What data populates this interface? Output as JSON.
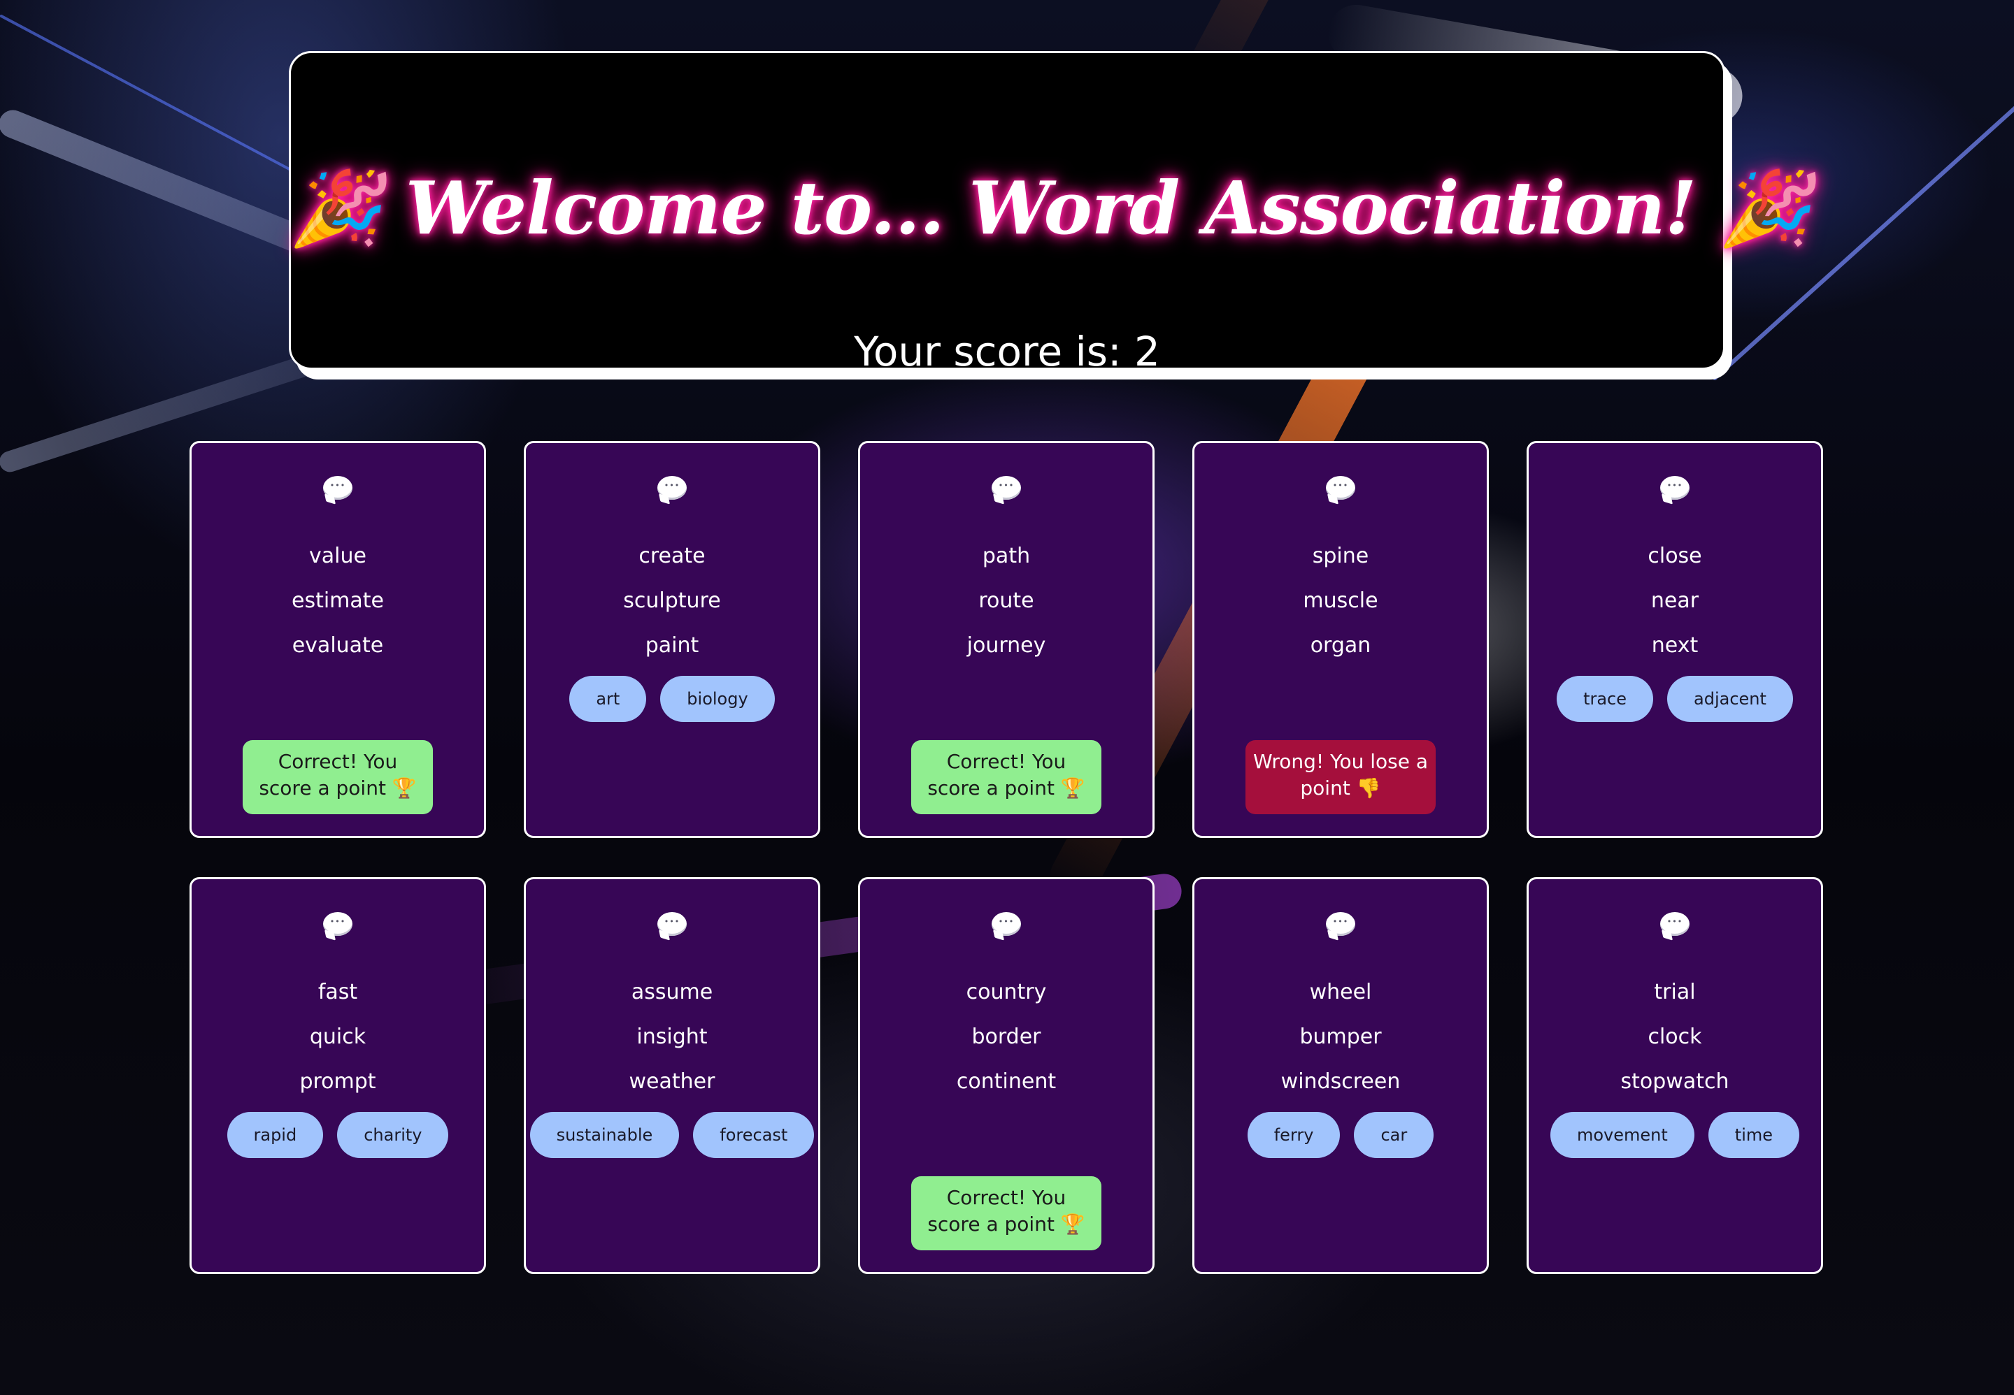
{
  "header": {
    "title": "🎉 Welcome to... Word Association! 🎉",
    "score_label": "Your score is: 2"
  },
  "colors": {
    "card_bg": "#370656",
    "chip_bg": "#a1c4fd",
    "correct_bg": "#90ee90",
    "wrong_bg": "#a50f3c",
    "title_glow": "#ff1493"
  },
  "cards": [
    {
      "words": [
        "value",
        "estimate",
        "evaluate"
      ],
      "options": [],
      "result": "Correct! You score a point 🏆",
      "result_type": "correct"
    },
    {
      "words": [
        "create",
        "sculpture",
        "paint"
      ],
      "options": [
        "art",
        "biology"
      ],
      "result": "",
      "result_type": "none"
    },
    {
      "words": [
        "path",
        "route",
        "journey"
      ],
      "options": [],
      "result": "Correct! You score a point 🏆",
      "result_type": "correct"
    },
    {
      "words": [
        "spine",
        "muscle",
        "organ"
      ],
      "options": [],
      "result": "Wrong! You lose a point 👎",
      "result_type": "wrong"
    },
    {
      "words": [
        "close",
        "near",
        "next"
      ],
      "options": [
        "trace",
        "adjacent"
      ],
      "result": "",
      "result_type": "none"
    },
    {
      "words": [
        "fast",
        "quick",
        "prompt"
      ],
      "options": [
        "rapid",
        "charity"
      ],
      "result": "",
      "result_type": "none"
    },
    {
      "words": [
        "assume",
        "insight",
        "weather"
      ],
      "options": [
        "sustainable",
        "forecast"
      ],
      "result": "",
      "result_type": "none"
    },
    {
      "words": [
        "country",
        "border",
        "continent"
      ],
      "options": [],
      "result": "Correct! You score a point 🏆",
      "result_type": "correct"
    },
    {
      "words": [
        "wheel",
        "bumper",
        "windscreen"
      ],
      "options": [
        "ferry",
        "car"
      ],
      "result": "",
      "result_type": "none"
    },
    {
      "words": [
        "trial",
        "clock",
        "stopwatch"
      ],
      "options": [
        "movement",
        "time"
      ],
      "result": "",
      "result_type": "none"
    }
  ]
}
